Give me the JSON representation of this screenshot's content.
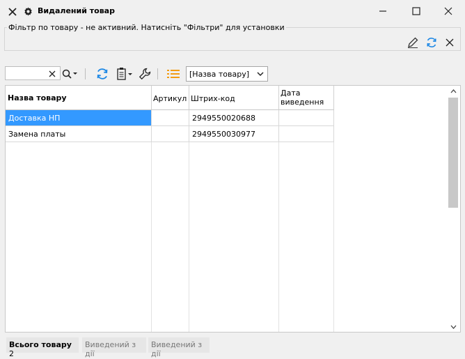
{
  "window": {
    "title": "Видалений товар",
    "close_icon": "close-icon",
    "settings_icon": "gear-icon",
    "minimize_icon": "minimize-icon",
    "maximize_icon": "maximize-icon",
    "window_close_icon": "close-icon"
  },
  "filter": {
    "text": "Фільтр по товару - не активний. Натисніть \"Фільтри\" для установки"
  },
  "toolbar": {
    "search_value": "",
    "sort_field": "[Назва товару]"
  },
  "grid": {
    "columns": [
      "Назва товару",
      "Артикул",
      "Штрих-код",
      "Дата\nвиведення"
    ],
    "rows": [
      {
        "name": "Доставка НП",
        "article": "",
        "barcode": "2949550020688",
        "date": ""
      },
      {
        "name": "Замена платы",
        "article": "",
        "barcode": "2949550030977",
        "date": ""
      }
    ],
    "selected_row": 0
  },
  "status": {
    "total_label": "Всього товару",
    "total_count": "2",
    "chip2": "Виведений з дії",
    "chip3": "Виведений з дії"
  },
  "colors": {
    "accent_blue": "#1e88e5",
    "selection": "#3399ff",
    "orange": "#f39c12"
  }
}
